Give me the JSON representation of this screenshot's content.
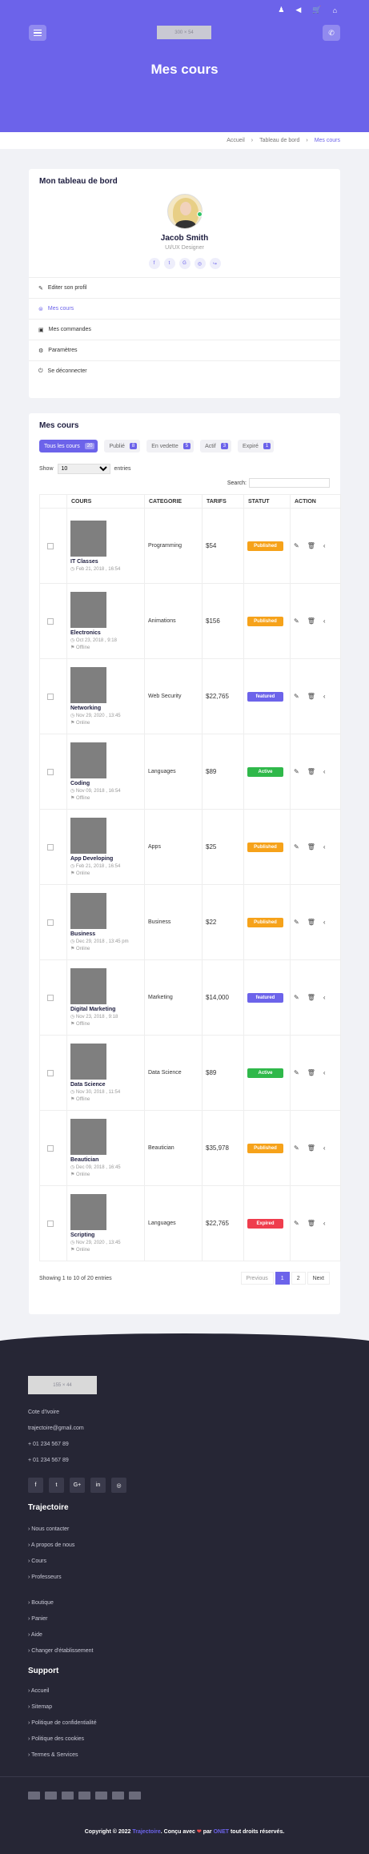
{
  "topbar": {
    "icons": [
      "user-icon",
      "megaphone-icon",
      "cart-icon",
      "home-icon"
    ],
    "glyphs": [
      "♟",
      "◀",
      "🛒",
      "⌂"
    ]
  },
  "header": {
    "logo_text": "300 × 54",
    "page_title": "Mes cours"
  },
  "breadcrumb": {
    "home": "Accueil",
    "dashboard": "Tableau de bord",
    "current": "Mes cours",
    "sep": "›"
  },
  "dashboard": {
    "title": "Mon tableau de bord",
    "name": "Jacob Smith",
    "role": "UI/UX Designer",
    "socials": [
      "f",
      "t",
      "G",
      "◎",
      "↪"
    ],
    "menu": [
      "Editer son profil",
      "Mes cours",
      "Mes commandes",
      "Paramètres",
      "Se déconnecter"
    ],
    "menu_icons": [
      "✎",
      "⊜",
      "▣",
      "⚙",
      "⏻"
    ]
  },
  "courses": {
    "title": "Mes cours",
    "tabs": [
      {
        "label": "Tous les cours",
        "count": "20"
      },
      {
        "label": "Publié",
        "count": "8"
      },
      {
        "label": "En vedette",
        "count": "5"
      },
      {
        "label": "Actif",
        "count": "3"
      },
      {
        "label": "Expiré",
        "count": "1"
      }
    ],
    "show_label": "Show",
    "show_value": "10",
    "entries_label": "entries",
    "search_label": "Search:",
    "headers": [
      "COURS",
      "CATEGORIE",
      "TARIFS",
      "STATUT",
      "ACTION"
    ],
    "rows": [
      {
        "title": "IT Classes",
        "date": "Feb 21, 2018 , 16:54",
        "mode": "",
        "category": "Programming",
        "price": "$54",
        "status": "Published"
      },
      {
        "title": "Electronics",
        "date": "Oct 23, 2018 , 9:18",
        "mode": "Offline",
        "category": "Animations",
        "price": "$156",
        "status": "Published"
      },
      {
        "title": "Networking",
        "date": "Nov 29, 2020 , 13:45",
        "mode": "Online",
        "category": "Web Security",
        "price": "$22,765",
        "status": "featured"
      },
      {
        "title": "Coding",
        "date": "Nov 09, 2018 , 16:54",
        "mode": "Offline",
        "category": "Languages",
        "price": "$89",
        "status": "Active"
      },
      {
        "title": "App Developing",
        "date": "Feb 21, 2018 , 16:54",
        "mode": "Online",
        "category": "Apps",
        "price": "$25",
        "status": "Published"
      },
      {
        "title": "Business",
        "date": "Dec 29, 2018 , 13:45 pm",
        "mode": "Online",
        "category": "Business",
        "price": "$22",
        "status": "Published"
      },
      {
        "title": "Digital Marketing",
        "date": "Nov 23, 2018 , 9:18",
        "mode": "Offline",
        "category": "Marketing",
        "price": "$14,000",
        "status": "featured"
      },
      {
        "title": "Data Science",
        "date": "Nov 30, 2018 , 11:54",
        "mode": "Offline",
        "category": "Data Science",
        "price": "$89",
        "status": "Active"
      },
      {
        "title": "Beautician",
        "date": "Dec 09, 2018 , 16:45",
        "mode": "Online",
        "category": "Beautician",
        "price": "$35,978",
        "status": "Published"
      },
      {
        "title": "Scripting",
        "date": "Nov 29, 2020 , 13:45",
        "mode": "Online",
        "category": "Languages",
        "price": "$22,765",
        "status": "Expired"
      }
    ],
    "status_colors": {
      "Published": "#f6a21a",
      "featured": "#6c63ea",
      "Active": "#2fb84a",
      "Expired": "#ef3d4d"
    },
    "info": "Showing 1 to 10 of 20 entries",
    "pagination": {
      "prev": "Previous",
      "p1": "1",
      "p2": "2",
      "next": "Next"
    }
  },
  "footer": {
    "logo_text": "155 × 44",
    "address": "Cote d'Ivoire",
    "email": "trajectoire@gmail.com",
    "phone1": "+ 01 234 567 89",
    "phone2": "+ 01 234 567 89",
    "socials": [
      "f",
      "t",
      "G+",
      "in",
      "◎"
    ],
    "trajectoire_title": "Trajectoire",
    "links1": [
      "Nous contacter",
      "A propos de nous",
      "Cours",
      "Professeurs"
    ],
    "links2": [
      "Boutique",
      "Panier",
      "Aide",
      "Changer d'établissement"
    ],
    "support_title": "Support",
    "support_links": [
      "Accueil",
      "Sitemap",
      "Politique de confidentialité",
      "Politique des cookies",
      "Termes & Services"
    ],
    "copy_a": "Copyright © 2022 ",
    "copy_brand": "Trajectoire",
    "copy_b": ". Conçu avec ",
    "copy_heart": "❤",
    "copy_c": " par ",
    "copy_by": "ONET",
    "copy_d": " tout droits réservés."
  },
  "colors": {
    "accent": "#6c63ea",
    "footer_bg": "#262635"
  }
}
